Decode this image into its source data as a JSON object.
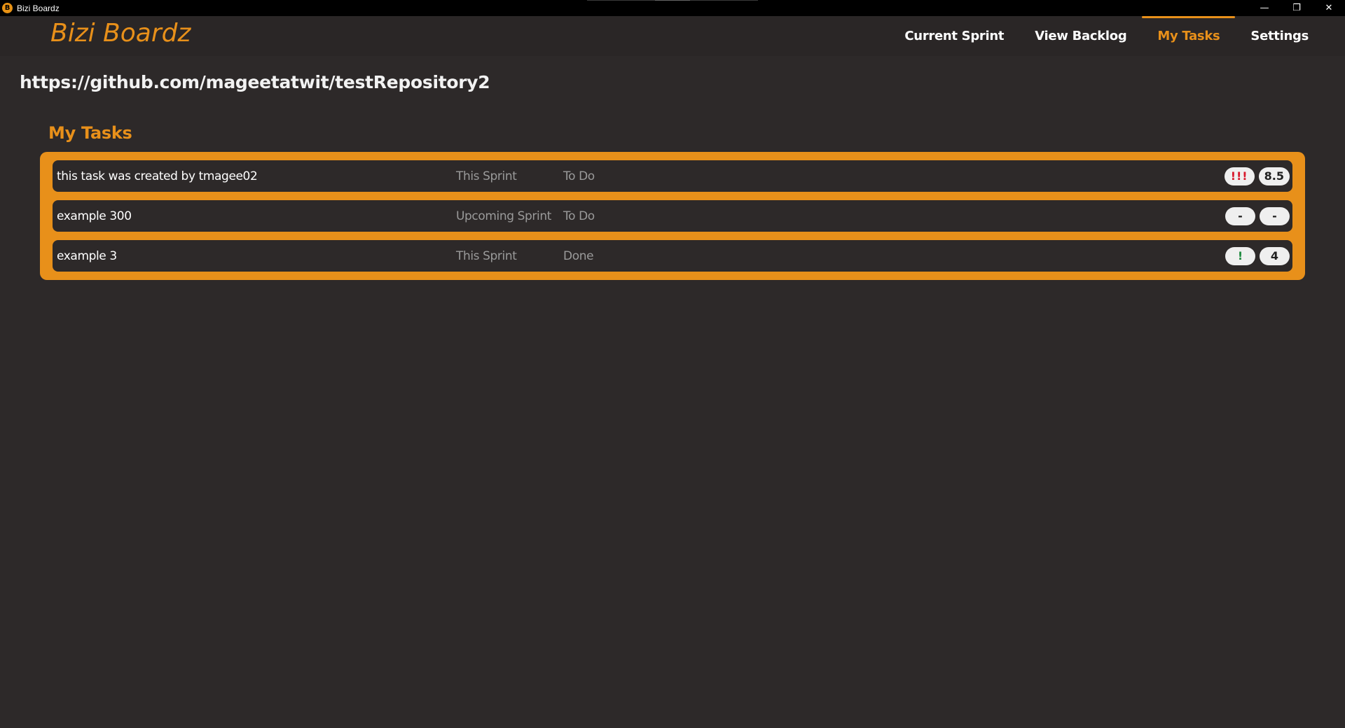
{
  "window": {
    "title": "Bizi Boardz",
    "icon_glyph": "B",
    "controls": {
      "minimize": "—",
      "restore": "❐",
      "close": "✕"
    }
  },
  "brand": "Bizi Boardz",
  "nav": {
    "items": [
      {
        "label": "Current Sprint",
        "active": false
      },
      {
        "label": "View Backlog",
        "active": false
      },
      {
        "label": "My Tasks",
        "active": true
      },
      {
        "label": "Settings",
        "active": false
      }
    ]
  },
  "repo_url": "https://github.com/mageetatwit/testRepository2",
  "section": {
    "title": "My Tasks",
    "tasks": [
      {
        "name": "this task was created by tmagee02",
        "sprint": "This Sprint",
        "status": "To Do",
        "priority": "!!!",
        "points": "8.5"
      },
      {
        "name": "example 300",
        "sprint": "Upcoming Sprint",
        "status": "To Do",
        "priority": "-",
        "points": "-"
      },
      {
        "name": "example 3",
        "sprint": "This Sprint",
        "status": "Done",
        "priority": "!",
        "points": "4"
      }
    ]
  },
  "colors": {
    "accent": "#e8901a",
    "background": "#2d2929",
    "priority_high": "#d8182b",
    "priority_low": "#1e8a3e"
  }
}
